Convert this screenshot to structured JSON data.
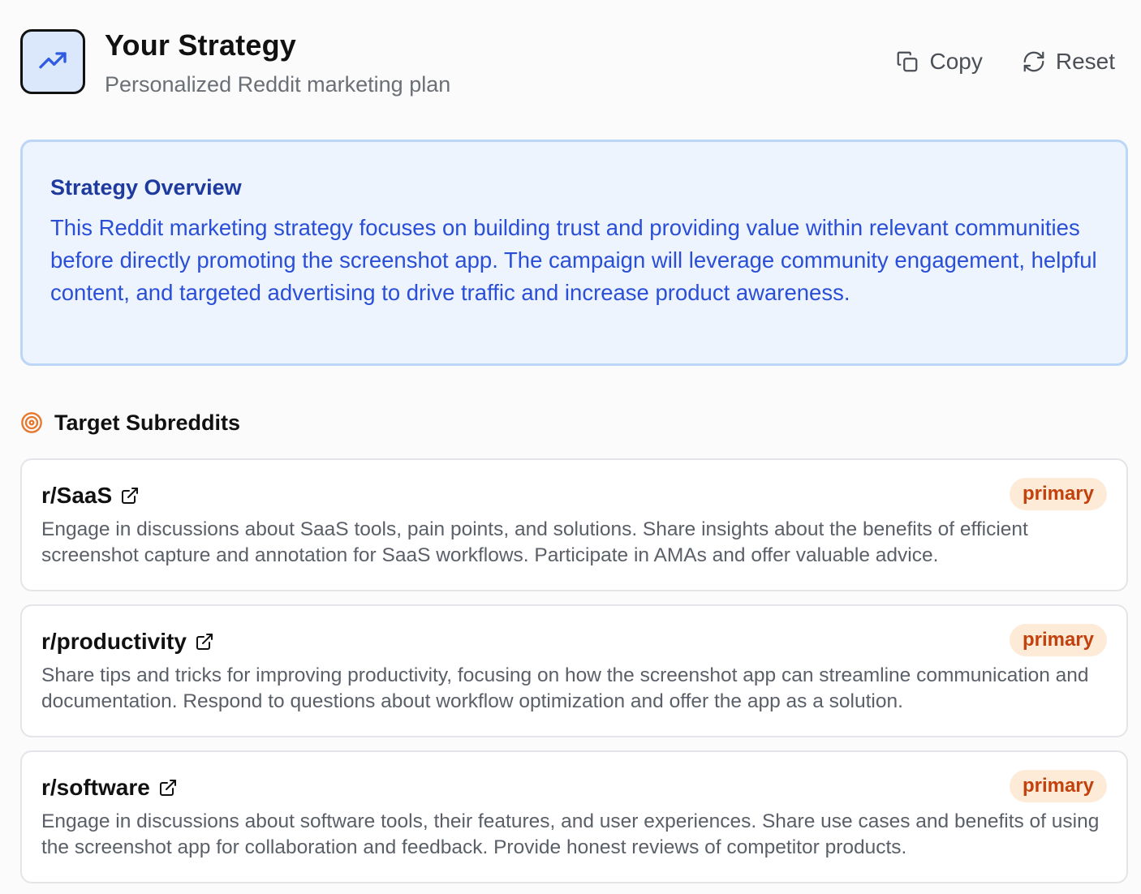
{
  "header": {
    "title": "Your Strategy",
    "subtitle": "Personalized Reddit marketing plan",
    "logo_icon": "trending-up-icon",
    "actions": {
      "copy_label": "Copy",
      "copy_icon": "copy-icon",
      "reset_label": "Reset",
      "reset_icon": "refresh-icon"
    }
  },
  "overview": {
    "title": "Strategy Overview",
    "text": "This Reddit marketing strategy focuses on building trust and providing value within relevant communities before directly promoting the screenshot app. The campaign will leverage community engagement, helpful content, and targeted advertising to drive traffic and increase product awareness."
  },
  "subreddits": {
    "section_title": "Target Subreddits",
    "section_icon": "target-icon",
    "items": [
      {
        "name": "r/SaaS",
        "badge": "primary",
        "description": "Engage in discussions about SaaS tools, pain points, and solutions. Share insights about the benefits of efficient screenshot capture and annotation for SaaS workflows. Participate in AMAs and offer valuable advice."
      },
      {
        "name": "r/productivity",
        "badge": "primary",
        "description": "Share tips and tricks for improving productivity, focusing on how the screenshot app can streamline communication and documentation. Respond to questions about workflow optimization and offer the app as a solution."
      },
      {
        "name": "r/software",
        "badge": "primary",
        "description": "Engage in discussions about software tools, their features, and user experiences. Share use cases and benefits of using the screenshot app for collaboration and feedback. Provide honest reviews of competitor products."
      }
    ]
  },
  "colors": {
    "accent_blue": "#2a4fd6",
    "overview_bg": "#edf4fe",
    "badge_bg": "#fdebd8",
    "badge_text": "#c2410c",
    "target_icon": "#e8772e"
  }
}
